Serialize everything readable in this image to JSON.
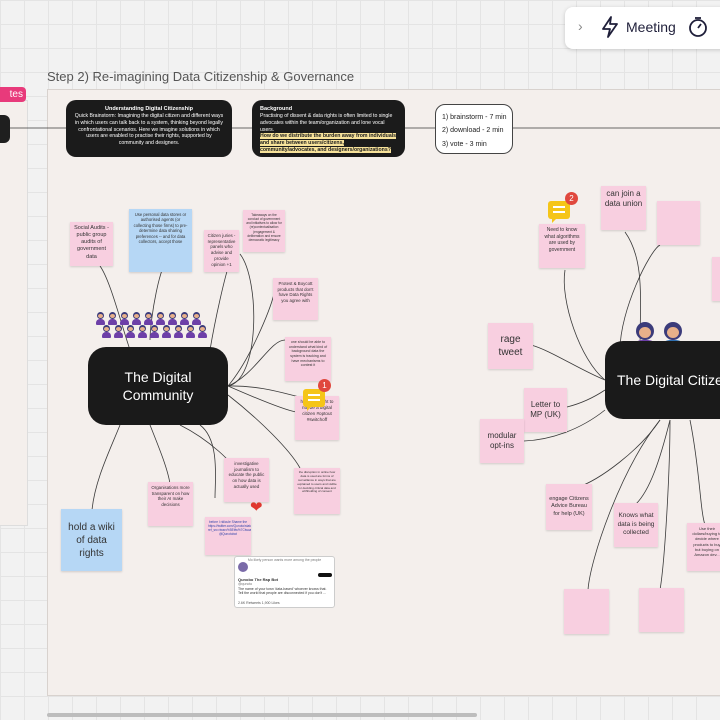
{
  "toolbar": {
    "meeting_label": "Meeting",
    "icons": [
      "chevron-right-icon",
      "lightning-icon",
      "timer-icon"
    ]
  },
  "left_frame": {
    "tab_label": "tes"
  },
  "frame": {
    "title": "Step 2) Re-imagining Data Citizenship & Governance"
  },
  "cards": {
    "understanding": {
      "title": "Understanding Digital Citizenship",
      "body": "Quick Brainstorm: Imagining the digital citizen and different ways in which users can talk back to a system, thinking beyond legally confrontational scenarios. Here we imagine solutions in which users are enabled to practise their rights, supported by community and designers."
    },
    "background": {
      "title": "Background",
      "body": "Practising of dissent & data rights is often limited to single advocates within the team/organization and lone vocal users.",
      "question": "How do we distribute the burden away from individuals and share between users/citizens, community/advocates, and designers/organizations?"
    },
    "timing": [
      "1) brainstorm - 7 min",
      "2) download - 2 min",
      "3) vote - 3 min"
    ]
  },
  "mindmap_left": {
    "center": "The Digital Community",
    "stickies": {
      "social_audits": "Social Audits - public group audits of government data",
      "personal_data_stores": "Use personal data stores or authorised agents (or collecting those firms) to pre-determine data sharing preferences -- and for data collectors, accept those",
      "citizen_juries": "Citizen juries - representative panels who advise and provide opinion +1",
      "transparency": "Takeaways on the conduct of government and initiatives to allow for (re)contextualisation (engagement & deliberation and ensure democratic legitimacy",
      "protest": "Protest & Boycott products that don't have Data Rights you agree with",
      "understand": "one should be able to understand what kind of background data the system is tracking and have mechanisms to contest it",
      "right_to_not_be": "have the right to not be a digital citizen #optout #switchoff",
      "journalism": "investigative journalism to educate the public on how data is actually used",
      "organisations": "Organisations more transparent on how their AI make decisions",
      "disruption": "the disruption in online how data is used are forms of surveillance in ways that are explained to users and visible for deciding critical data and withholding of consent",
      "wiki": "hold a wiki of data rights",
      "link_note": "before I ridicule Shame the https://twitter.com/Qunoto/status/... ref_src=twsrc%5Etfw%7Ctwcamp%5Etweetembed%7Ctwterm%5E... @Qunotobot"
    },
    "comment_count": "1",
    "tweet": {
      "header": "Mo likely person wants more among the people",
      "name": "Qunobo The Rap Bot",
      "handle": "@qunoto",
      "text": "The name of your town 'data-based' whoever knows that. Tell the world that people are disconnected if you don't ...",
      "stats": "2.6K Retweets 1,900 Likes"
    }
  },
  "mindmap_right": {
    "center": "The Digital Citizen",
    "comment_count": "2",
    "stickies": {
      "need_to_know": "Need to know what algorithms are used by government",
      "join_union": "can join a data union",
      "rage_tweet": "rage tweet",
      "letter_mp": "Letter to MP (UK)",
      "modular": "modular opt-ins",
      "citizens_advice": "engage Citizens Advice Bureau for help (UK)",
      "knows_data": "Knows what data is being collected",
      "dollars": "Use their dollars/buying to decide where products to buy but buying on Amazon dev..."
    }
  },
  "colors": {
    "sticky_pink": "#f8cfe0",
    "sticky_blue": "#b6d7f5",
    "node_dark": "#1a1a1a",
    "highlight": "#f7e29a",
    "accent_pink": "#e83a7b"
  }
}
